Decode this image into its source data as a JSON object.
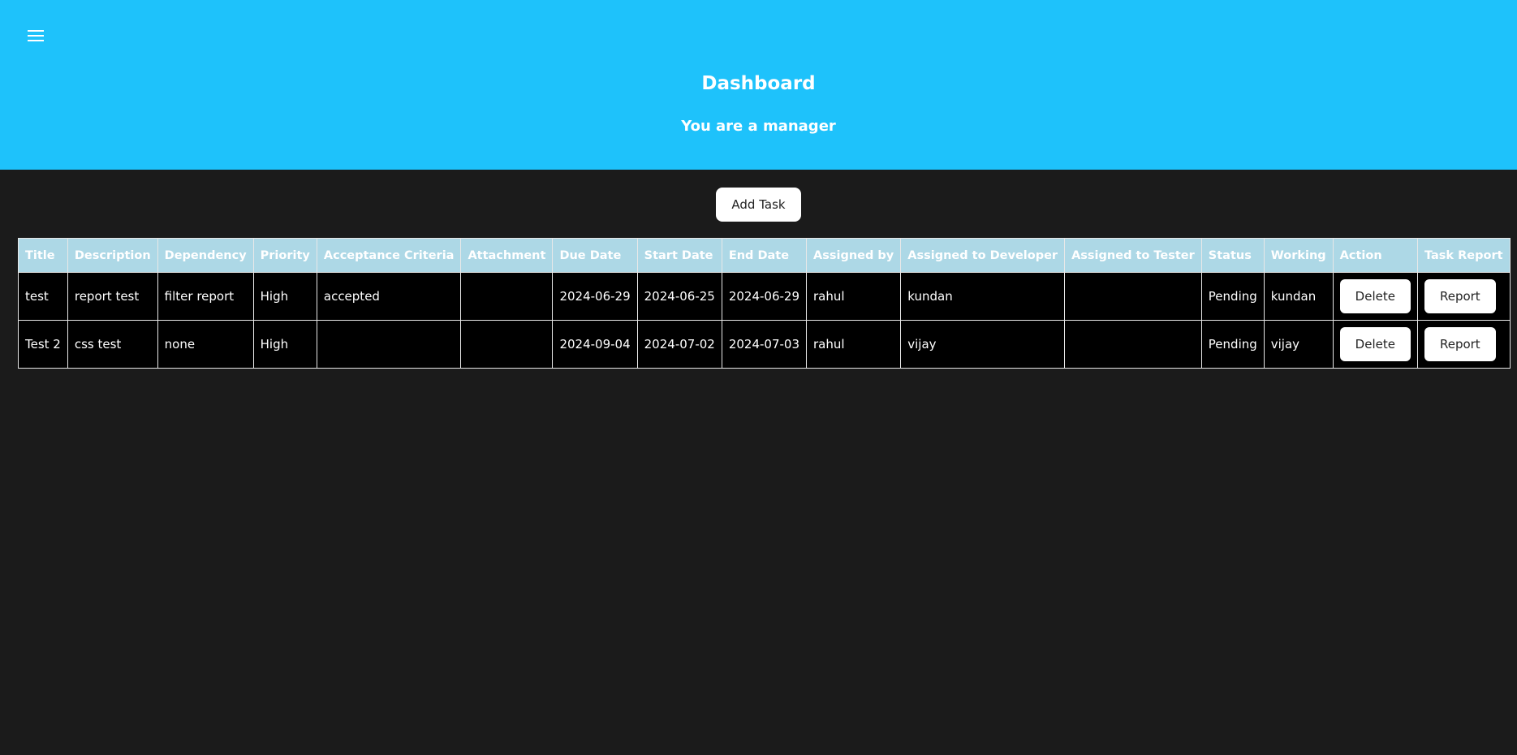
{
  "header": {
    "title": "Dashboard",
    "subtitle": "You are a manager",
    "menu_icon": "hamburger-menu-icon"
  },
  "toolbar": {
    "add_task_label": "Add Task"
  },
  "table": {
    "columns": [
      "Title",
      "Description",
      "Dependency",
      "Priority",
      "Acceptance Criteria",
      "Attachment",
      "Due Date",
      "Start Date",
      "End Date",
      "Assigned by",
      "Assigned to Developer",
      "Assigned to Tester",
      "Status",
      "Working",
      "Action",
      "Task Report"
    ],
    "rows": [
      {
        "title": "test",
        "description": "report test",
        "dependency": "filter report",
        "priority": "High",
        "acceptance_criteria": "accepted",
        "attachment": "",
        "due_date": "2024-06-29",
        "start_date": "2024-06-25",
        "end_date": "2024-06-29",
        "assigned_by": "rahul",
        "assigned_developer": "kundan",
        "assigned_tester": "",
        "status": "Pending",
        "working": "kundan",
        "action_label": "Delete",
        "report_label": "Report"
      },
      {
        "title": "Test 2",
        "description": "css test",
        "dependency": "none",
        "priority": "High",
        "acceptance_criteria": "",
        "attachment": "",
        "due_date": "2024-09-04",
        "start_date": "2024-07-02",
        "end_date": "2024-07-03",
        "assigned_by": "rahul",
        "assigned_developer": "vijay",
        "assigned_tester": "",
        "status": "Pending",
        "working": "vijay",
        "action_label": "Delete",
        "report_label": "Report"
      }
    ]
  },
  "colors": {
    "header_bg": "#1ec2fb",
    "page_bg": "#1b1b1b",
    "table_header_bg": "#add8e6",
    "table_row_bg": "#000000"
  }
}
